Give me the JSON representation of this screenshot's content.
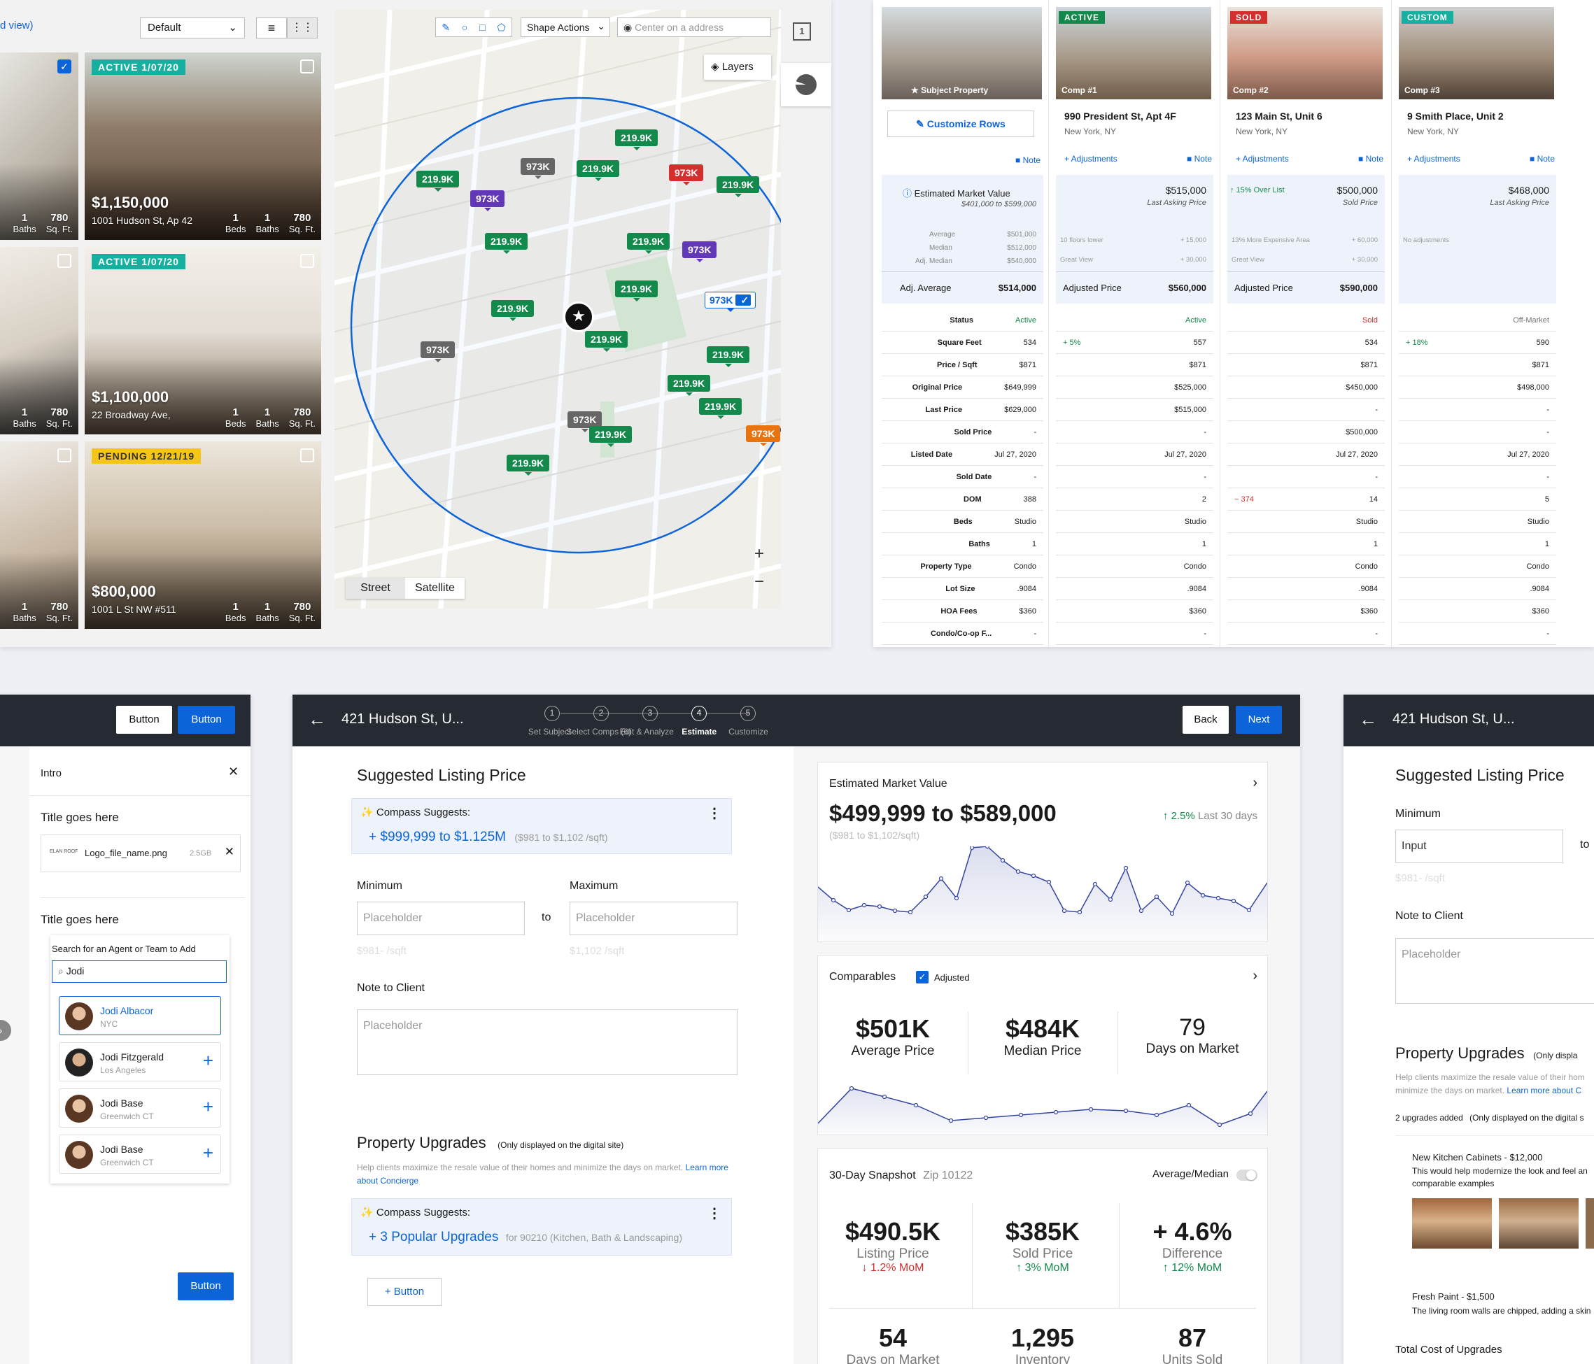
{
  "listings": {
    "view_label": "d view)",
    "sort_value": "Default",
    "cards": [
      {
        "badge": "ACTIVE 1/07/20",
        "price": "$1,150,000",
        "address": "1001 Hudson St, Ap 42",
        "beds": "1",
        "beds_label": "Beds",
        "baths": "1",
        "baths_label": "Baths",
        "sqft": "780",
        "sqft_label": "Sq. Ft."
      },
      {
        "badge": "ACTIVE 1/07/20",
        "price": "$1,100,000",
        "address": "22 Broadway Ave,",
        "beds": "1",
        "beds_label": "Beds",
        "baths": "1",
        "baths_label": "Baths",
        "sqft": "780",
        "sqft_label": "Sq. Ft."
      },
      {
        "badge": "PENDING 12/21/19",
        "price": "$800,000",
        "address": "1001 L St NW #511",
        "beds": "1",
        "beds_label": "Beds",
        "baths": "1",
        "baths_label": "Baths",
        "sqft": "780",
        "sqft_label": "Sq. Ft."
      }
    ],
    "left_partial": [
      {
        "baths": "1",
        "baths_label": "Baths",
        "sqft": "780",
        "sqft_label": "Sq. Ft."
      },
      {
        "baths": "1",
        "baths_label": "Baths",
        "sqft": "780",
        "sqft_label": "Sq. Ft."
      },
      {
        "baths": "1",
        "baths_label": "Baths",
        "sqft": "780",
        "sqft_label": "Sq. Ft."
      }
    ]
  },
  "map": {
    "shape_actions": "Shape Actions",
    "center_placeholder": "Center on a address",
    "layers": "Layers",
    "street": "Street",
    "satellite": "Satellite",
    "count_badge": "1",
    "zoom_in": "+",
    "zoom_out": "−",
    "pins": [
      {
        "label": "219.9K",
        "color": "green"
      },
      {
        "label": "973K",
        "color": "grey"
      },
      {
        "label": "219.9K",
        "color": "green"
      },
      {
        "label": "973K",
        "color": "red"
      },
      {
        "label": "219.9K",
        "color": "green"
      },
      {
        "label": "219.9K",
        "color": "green"
      },
      {
        "label": "973K",
        "color": "purple"
      },
      {
        "label": "219.9K",
        "color": "green"
      },
      {
        "label": "219.9K",
        "color": "green"
      },
      {
        "label": "973K",
        "color": "purple"
      },
      {
        "label": "219.9K",
        "color": "green"
      },
      {
        "label": "219.9K",
        "color": "green"
      },
      {
        "label": "973K",
        "color": "grey"
      },
      {
        "label": "219.9K",
        "color": "green"
      },
      {
        "label": "219.9K",
        "color": "green"
      },
      {
        "label": "219.9K",
        "color": "green"
      },
      {
        "label": "973K",
        "color": "grey"
      },
      {
        "label": "219.9K",
        "color": "green"
      },
      {
        "label": "219.9K",
        "color": "green"
      },
      {
        "label": "973K",
        "color": "orange"
      },
      {
        "label": "219.9K",
        "color": "green"
      },
      {
        "label": "973K",
        "color": "selected"
      }
    ]
  },
  "comps": {
    "customize_rows": "Customize Rows",
    "note": "Note",
    "adjustments": "+ Adjustments",
    "subject": {
      "label": "★ Subject Property",
      "emv_title": "Estimated Market Value",
      "emv_range": "$401,000 to $599,000",
      "stats": [
        {
          "k": "Average",
          "v": "$501,000"
        },
        {
          "k": "Median",
          "v": "$512,000"
        },
        {
          "k": "Adj. Median",
          "v": "$540,000"
        }
      ],
      "adj_avg_label": "Adj. Average",
      "adj_avg": "$514,000"
    },
    "columns": [
      {
        "badge": "ACTIVE",
        "label": "Comp #1",
        "title": "990 President St, Apt 4F",
        "city": "New York, NY",
        "price": "$515,000",
        "price_sub": "Last Asking Price",
        "tag": "",
        "adj": [
          {
            "k": "10 floors lower",
            "v": "+ 15,000"
          },
          {
            "k": "Great View",
            "v": "+ 30,000"
          }
        ],
        "adjusted_label": "Adjusted Price",
        "adjusted": "$560,000"
      },
      {
        "badge": "SOLD",
        "label": "Comp #2",
        "title": "123 Main St, Unit 6",
        "city": "New York, NY",
        "price": "$500,000",
        "price_sub": "Sold Price",
        "tag": "↑ 15% Over List",
        "adj": [
          {
            "k": "13% More Expensive Area",
            "v": "+ 60,000"
          },
          {
            "k": "Great View",
            "v": "+ 30,000"
          }
        ],
        "adjusted_label": "Adjusted Price",
        "adjusted": "$590,000"
      },
      {
        "badge": "CUSTOM",
        "label": "Comp #3",
        "title": "9 Smith Place, Unit 2",
        "city": "New York, NY",
        "price": "$468,000",
        "price_sub": "Last Asking Price",
        "tag": "",
        "adj": [
          {
            "k": "No adjustments",
            "v": ""
          }
        ],
        "adjusted_label": "",
        "adjusted": ""
      }
    ],
    "row_labels": [
      "Status",
      "Square Feet",
      "Price / Sqft",
      "Original Price",
      "Last Price",
      "Sold Price",
      "Listed Date",
      "Sold Date",
      "DOM",
      "Beds",
      "Baths",
      "Property Type",
      "Lot Size",
      "HOA Fees",
      "Condo/Co-op F..."
    ],
    "values": [
      [
        "Active",
        "534",
        "$871",
        "$649,999",
        "$629,000",
        "-",
        "Jul 27, 2020",
        "-",
        "388",
        "Studio",
        "1",
        "Condo",
        ".9084",
        "$360",
        "-"
      ],
      [
        "Active",
        "557",
        "$871",
        "$525,000",
        "$515,000",
        "-",
        "Jul 27, 2020",
        "-",
        "2",
        "Studio",
        "1",
        "Condo",
        ".9084",
        "$360",
        "-"
      ],
      [
        "Sold",
        "534",
        "$871",
        "$450,000",
        "-",
        "$500,000",
        "Jul 27, 2020",
        "-",
        "14",
        "Studio",
        "1",
        "Condo",
        ".9084",
        "$360",
        "-"
      ],
      [
        "Off-Market",
        "590",
        "$871",
        "$498,000",
        "-",
        "-",
        "Jul 27, 2020",
        "-",
        "5",
        "Studio",
        "1",
        "Condo",
        ".9084",
        "$360",
        "-"
      ]
    ],
    "side_notes": [
      [
        "",
        "+ 5%",
        "",
        "",
        "",
        "",
        "",
        "",
        "",
        "",
        "",
        "",
        "",
        "",
        ""
      ],
      [
        "",
        "",
        "",
        "",
        "",
        "",
        "",
        "",
        "− 374",
        "",
        "",
        "",
        "",
        "",
        ""
      ],
      [
        "",
        "+ 18%",
        "",
        "",
        "",
        "",
        "",
        "",
        "",
        "",
        "",
        "",
        "",
        "",
        ""
      ]
    ]
  },
  "sidebar_panel": {
    "btn1": "Button",
    "btn2": "Button",
    "intro": "Intro",
    "title1": "Title goes here",
    "file_name": "Logo_file_name.png",
    "file_size": "2.5GB",
    "file_logo": "ELAN ROOF",
    "title2": "Title goes here",
    "search_label": "Search for an Agent or Team to Add",
    "search_value": "Jodi",
    "agents": [
      {
        "name": "Jodi Albacor",
        "loc": "NYC"
      },
      {
        "name": "Jodi Fitzgerald",
        "loc": "Los Angeles"
      },
      {
        "name": "Jodi Base",
        "loc": "Greenwich CT"
      },
      {
        "name": "Jodi Base",
        "loc": "Greenwich CT"
      }
    ],
    "bottom_btn": "Button"
  },
  "main": {
    "address": "421 Hudson St,  U...",
    "steps": [
      {
        "n": "1",
        "label": "Set Subject"
      },
      {
        "n": "2",
        "label": "Select Comps (6)"
      },
      {
        "n": "3",
        "label": "Edit & Analyze"
      },
      {
        "n": "4",
        "label": "Estimate"
      },
      {
        "n": "5",
        "label": "Customize"
      }
    ],
    "back": "Back",
    "next": "Next",
    "slp_title": "Suggested Listing Price",
    "suggests": "Compass Suggests:",
    "suggest_value": "+ $999,999 to $1.125M",
    "suggest_sub": "($981 to $1,102 /sqft)",
    "min_label": "Minimum",
    "max_label": "Maximum",
    "placeholder": "Placeholder",
    "to": "to",
    "min_sqft": "$981- /sqft",
    "max_sqft": "$1,102 /sqft",
    "note_label": "Note to Client",
    "upgrades_title": "Property Upgrades",
    "upgrades_only": "(Only displayed on the digital site)",
    "upgrades_help": "Help clients maximize the resale value of their homes and minimize the days on market.",
    "learn_more": "Learn more about Concierge",
    "upg_value": "+ 3 Popular Upgrades",
    "upg_sub": "for 90210 (Kitchen, Bath & Landscaping)",
    "add_btn": "+ Button",
    "emv_title": "Estimated Market Value",
    "emv_value": "$499,999 to $589,000",
    "emv_sub": "($981 to $1,102/sqft)",
    "emv_change": "↑ 2.5%",
    "emv_change_lbl": "Last 30 days",
    "comparables": "Comparables",
    "adjusted": "Adjusted",
    "comp_stats": [
      {
        "v": "$501K",
        "l": "Average Price"
      },
      {
        "v": "$484K",
        "l": "Median Price"
      },
      {
        "v": "79",
        "l": "Days on Market"
      }
    ],
    "snap_title": "30-Day Snapshot",
    "snap_zip": "Zip 10122",
    "avg_median": "Average/Median",
    "snap_stats": [
      {
        "v": "$490.5K",
        "l": "Listing Price",
        "c": "↓ 1.2% MoM",
        "cc": "#d32f2f"
      },
      {
        "v": "$385K",
        "l": "Sold Price",
        "c": "↑ 3% MoM",
        "cc": "#138a4c"
      },
      {
        "v": "+ 4.6%",
        "l": "Difference",
        "c": "↑ 12% MoM",
        "cc": "#138a4c"
      }
    ],
    "snap_stats2": [
      {
        "v": "54",
        "l": "Days on Market"
      },
      {
        "v": "1,295",
        "l": "Inventory"
      },
      {
        "v": "87",
        "l": "Units Sold"
      }
    ]
  },
  "right_panel": {
    "address": "421 Hudson St,  U...",
    "slp_title": "Suggested Listing Price",
    "min_label": "Minimum",
    "input": "Input",
    "to": "to",
    "sqft": "$981- /sqft",
    "note_label": "Note to Client",
    "placeholder": "Placeholder",
    "upgrades_title": "Property Upgrades",
    "only": "(Only displa",
    "help": "Help clients maximize the resale value of their hom",
    "help2": "minimize the days on market.",
    "learn": "Learn more about C",
    "added": "2 upgrades added",
    "added_only": "(Only displayed on the digital s",
    "u1_title": "New Kitchen Cabinets - $12,000",
    "u1_desc": "This would help modernize the look and feel an",
    "u1_desc2": "comparable examples",
    "u2_title": "Fresh Paint - $1,500",
    "u2_desc": "The living room walls are chipped, adding a skin",
    "total": "Total Cost of Upgrades"
  },
  "colors": {
    "accent": "#0d64d8",
    "dark": "#262a33",
    "green": "#138a4c",
    "red": "#d32f2f",
    "purple": "#6237b8",
    "orange": "#e8730f",
    "teal": "#16b0a0"
  }
}
